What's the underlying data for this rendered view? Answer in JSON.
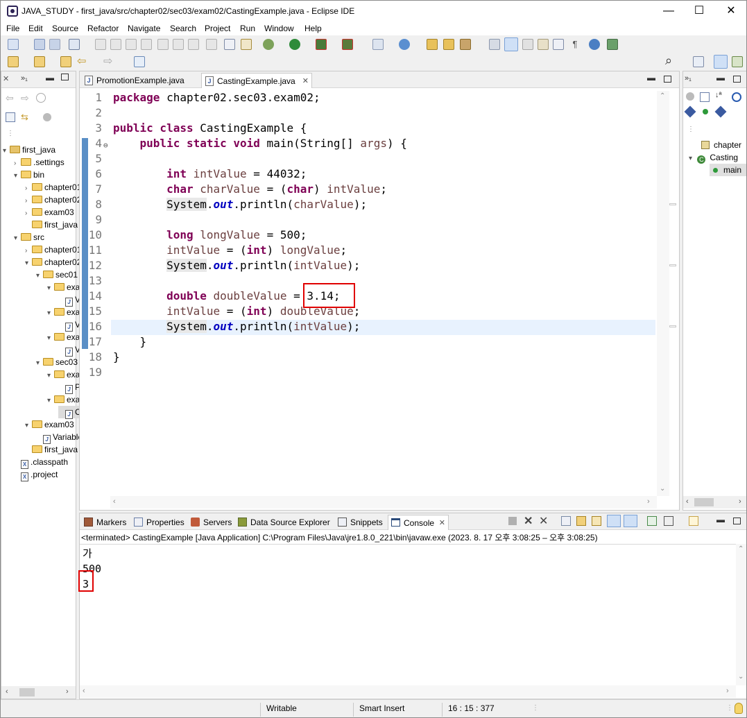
{
  "window": {
    "title": "JAVA_STUDY - first_java/src/chapter02/sec03/exam02/CastingExample.java - Eclipse IDE",
    "minimize": "—",
    "maximize": "☐",
    "close": "✕"
  },
  "menu": [
    "File",
    "Edit",
    "Source",
    "Refactor",
    "Navigate",
    "Search",
    "Project",
    "Run",
    "Window",
    "Help"
  ],
  "editor": {
    "tabs": [
      {
        "label": "PromotionExample.java"
      },
      {
        "label": "CastingExample.java",
        "close": "✕"
      }
    ],
    "line_numbers": [
      "1",
      "2",
      "3",
      "4",
      "5",
      "6",
      "7",
      "8",
      "9",
      "10",
      "11",
      "12",
      "13",
      "14",
      "15",
      "16",
      "17",
      "18",
      "19"
    ],
    "fold_marker": "⊖"
  },
  "explorer": {
    "items": [
      {
        "label": "first_java",
        "depth": 0,
        "kind": "project",
        "twisty": "▾"
      },
      {
        "label": ".settings",
        "depth": 1,
        "kind": "folder",
        "twisty": "›"
      },
      {
        "label": "bin",
        "depth": 1,
        "kind": "folder",
        "twisty": "▾"
      },
      {
        "label": "chapter01",
        "depth": 2,
        "kind": "folder",
        "twisty": "›"
      },
      {
        "label": "chapter02",
        "depth": 2,
        "kind": "folder",
        "twisty": "›"
      },
      {
        "label": "exam03",
        "depth": 2,
        "kind": "folder",
        "twisty": "›"
      },
      {
        "label": "first_java",
        "depth": 2,
        "kind": "folder",
        "twisty": ""
      },
      {
        "label": "src",
        "depth": 1,
        "kind": "folder",
        "twisty": "▾"
      },
      {
        "label": "chapter01",
        "depth": 2,
        "kind": "folder",
        "twisty": "›"
      },
      {
        "label": "chapter02",
        "depth": 2,
        "kind": "folder",
        "twisty": "▾"
      },
      {
        "label": "sec01",
        "depth": 3,
        "kind": "folder",
        "twisty": "▾"
      },
      {
        "label": "exar",
        "depth": 4,
        "kind": "folder",
        "twisty": "▾"
      },
      {
        "label": "V",
        "depth": 5,
        "kind": "java",
        "twisty": ""
      },
      {
        "label": "exar",
        "depth": 4,
        "kind": "folder",
        "twisty": "▾"
      },
      {
        "label": "V",
        "depth": 5,
        "kind": "java",
        "twisty": ""
      },
      {
        "label": "exar",
        "depth": 4,
        "kind": "folder",
        "twisty": "▾"
      },
      {
        "label": "V",
        "depth": 5,
        "kind": "java",
        "twisty": ""
      },
      {
        "label": "sec03",
        "depth": 3,
        "kind": "folder",
        "twisty": "▾"
      },
      {
        "label": "exar",
        "depth": 4,
        "kind": "folder",
        "twisty": "▾"
      },
      {
        "label": "P",
        "depth": 5,
        "kind": "java",
        "twisty": ""
      },
      {
        "label": "exar",
        "depth": 4,
        "kind": "folder",
        "twisty": "▾"
      },
      {
        "label": "C",
        "depth": 5,
        "kind": "java",
        "twisty": "",
        "selected": true
      },
      {
        "label": "exam03",
        "depth": 2,
        "kind": "folder",
        "twisty": "▾"
      },
      {
        "label": "Variable",
        "depth": 3,
        "kind": "java",
        "twisty": ""
      },
      {
        "label": "first_java",
        "depth": 2,
        "kind": "folder",
        "twisty": ""
      },
      {
        "label": ".classpath",
        "depth": 1,
        "kind": "xfile",
        "twisty": ""
      },
      {
        "label": ".project",
        "depth": 1,
        "kind": "xfile",
        "twisty": ""
      }
    ]
  },
  "outline": {
    "items": [
      {
        "label": "chapter"
      },
      {
        "label": "Casting"
      },
      {
        "label": "main"
      }
    ]
  },
  "bottom_panel": {
    "tabs": [
      "Markers",
      "Properties",
      "Servers",
      "Data Source Explorer",
      "Snippets",
      "Console"
    ],
    "console_status": "<terminated> CastingExample [Java Application] C:\\Program Files\\Java\\jre1.8.0_221\\bin\\javaw.exe  (2023. 8. 17 오후 3:08:25 – 오후 3:08:25)",
    "output": [
      "가",
      "500",
      "3"
    ]
  },
  "statusbar": {
    "mode": "Writable",
    "insert": "Smart Insert",
    "position": "16 : 15 : 377"
  },
  "colors": {
    "keyword": "#7f0055",
    "local_variable": "#6a3e3e",
    "static_field": "#0000c0",
    "current_line": "#e8f2fe",
    "highlight_box": "#e00000"
  }
}
